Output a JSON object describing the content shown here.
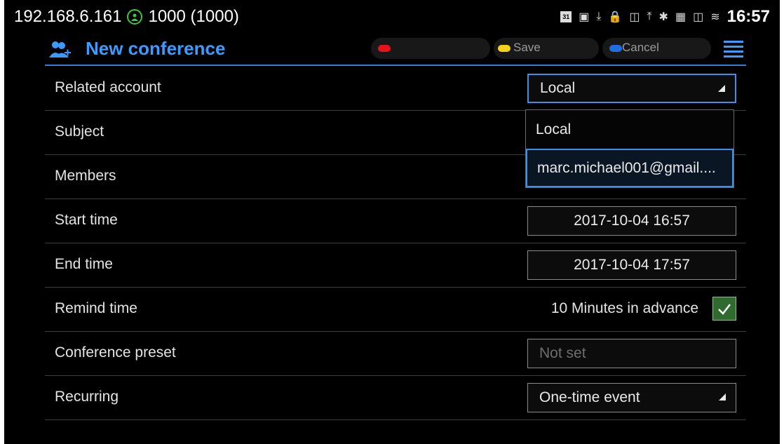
{
  "status_bar": {
    "ip_address": "192.168.6.161",
    "account": "1000 (1000)",
    "calendar_day": "31",
    "time": "16:57"
  },
  "header": {
    "title": "New conference",
    "save_label": "Save",
    "cancel_label": "Cancel",
    "colors": {
      "accent": "#3d9aff",
      "red": "#e8121a",
      "yellow": "#f2d21b",
      "blue": "#1f6fe0"
    }
  },
  "form": {
    "related_account": {
      "label": "Related account",
      "value": "Local"
    },
    "subject": {
      "label": "Subject"
    },
    "members": {
      "label": "Members"
    },
    "start_time": {
      "label": "Start time",
      "value": "2017-10-04 16:57"
    },
    "end_time": {
      "label": "End time",
      "value": "2017-10-04 17:57"
    },
    "remind_time": {
      "label": "Remind time",
      "value": "10 Minutes in advance",
      "checked": true
    },
    "conference_preset": {
      "label": "Conference preset",
      "placeholder": "Not set"
    },
    "recurring": {
      "label": "Recurring",
      "value": "One-time event"
    }
  },
  "account_dropdown": {
    "options": [
      "Local",
      "marc.michael001@gmail...."
    ],
    "selected_index": 1
  }
}
